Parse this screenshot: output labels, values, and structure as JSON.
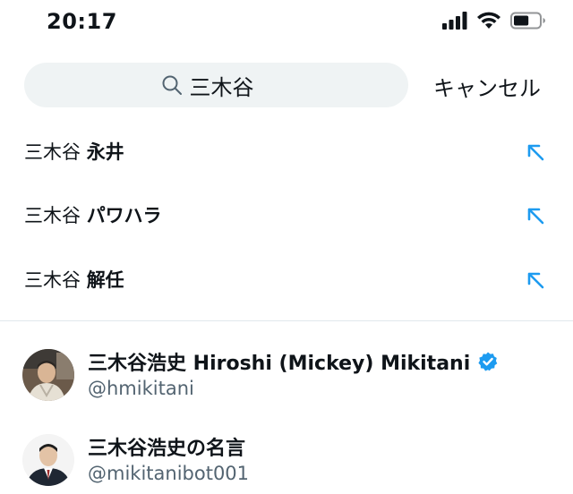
{
  "status_bar": {
    "time": "20:17",
    "battery_level": 0.6
  },
  "search": {
    "query": "三木谷",
    "cancel_label": "キャンセル"
  },
  "suggestions": [
    {
      "query": "三木谷",
      "suffix": "永井"
    },
    {
      "query": "三木谷",
      "suffix": "パワハラ"
    },
    {
      "query": "三木谷",
      "suffix": "解任"
    }
  ],
  "users": [
    {
      "name": "三木谷浩史 Hiroshi (Mickey) Mikitani",
      "handle": "@hmikitani",
      "verified": true
    },
    {
      "name": "三木谷浩史の名言",
      "handle": "@mikitanibot001",
      "verified": false
    }
  ],
  "colors": {
    "accent": "#1d9bf0",
    "search_bg": "#eff3f4",
    "secondary_text": "#536471",
    "divider": "#e1e8ed"
  },
  "icons": {
    "search": "magnifier-icon",
    "suggestion_arrow": "arrow-up-left-icon",
    "verified": "verified-badge-icon"
  }
}
